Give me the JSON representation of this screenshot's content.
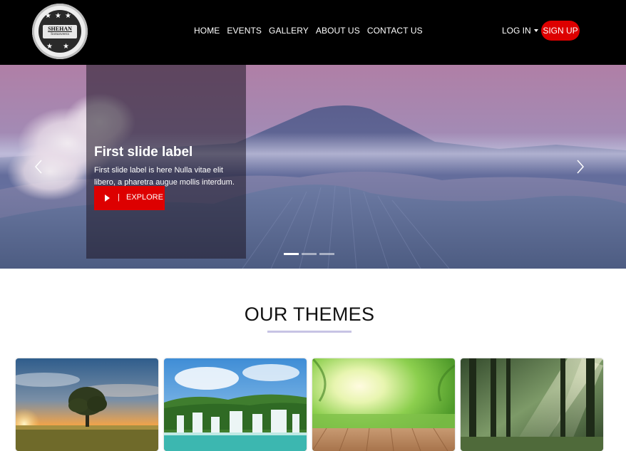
{
  "brand": {
    "logo_name": "SHEHAN",
    "logo_sub": "Somaweera"
  },
  "nav": {
    "links": [
      "HOME",
      "EVENTS",
      "GALLERY",
      "ABOUT US",
      "CONTACT US"
    ],
    "login_label": "LOG IN",
    "signup_label": "SIGN UP"
  },
  "carousel": {
    "title": "First slide label",
    "text": "First slide label is here Nulla vitae elit libero, a pharetra augue mollis interdum.",
    "button_separator": "|",
    "button_label": "EXPLORE",
    "indicators": 3,
    "active_indicator": 0
  },
  "themes": {
    "title": "OUR THEMES",
    "cards": [
      {
        "image": "sunset-tree-photo"
      },
      {
        "image": "waterfall-photo"
      },
      {
        "image": "sunny-meadow-deck-photo"
      },
      {
        "image": "forest-sunbeams-photo"
      }
    ]
  },
  "colors": {
    "navbar": "#000000",
    "accent_red": "#dd0000",
    "underline": "#c7c3e4"
  },
  "icons": {
    "carousel_prev": "chevron-left-icon",
    "carousel_next": "chevron-right-icon",
    "explore": "play-icon",
    "login_caret": "caret-down-icon"
  }
}
